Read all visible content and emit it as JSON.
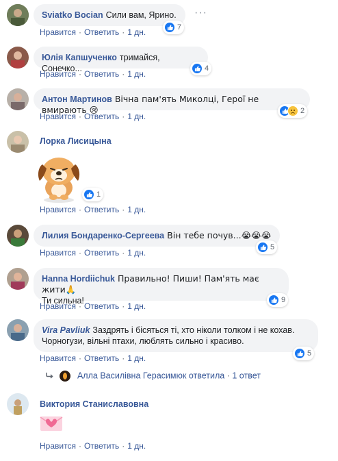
{
  "actions": {
    "like": "Нравится",
    "reply": "Ответить",
    "time": "1 дн."
  },
  "comments": [
    {
      "author": "Sviatko Bocian",
      "text": "Сили вам, Ярино.",
      "reactions": "7"
    },
    {
      "author": "Юлія Капшученко",
      "text": "тримайся, Сонечко...",
      "reactions": "4"
    },
    {
      "author": "Антон Мартинов",
      "text": "Вічна пам'ять Миколці, Герої не вмирають 😢",
      "reactions": "2"
    },
    {
      "author": "Лорка Лисицына",
      "text": "",
      "reactions": "1"
    },
    {
      "author": "Лилия Бондаренко-Сергеева",
      "text": "Він тебе почув...😭😭😭",
      "reactions": "5"
    },
    {
      "author": "Hanna Hordiichuk",
      "text": "Правильно! Пиши! Пам'ять має жити🙏",
      "text2": "Ти сильна!",
      "reactions": "9"
    },
    {
      "author": "Vira Pavliuk",
      "text": "Заздрять і бісяться ті, хто ніколи толком і не кохав.",
      "text2": "Чорногузи, вільні птахи, люблять сильно і красиво.",
      "reactions": "5"
    },
    {
      "author": "Виктория Станиславовна",
      "text": "",
      "reactions": ""
    }
  ],
  "reply": {
    "author": "Алла Василівна Герасимюк",
    "verb": "ответила",
    "count": "1 ответ"
  },
  "icons": {
    "like": "thumbs-up-icon",
    "sad": "sad-face-icon",
    "more": "more-options-icon",
    "reply": "reply-arrow-icon",
    "sticker": "puppy-sticker",
    "envelope": "heart-envelope-icon"
  },
  "colors": {
    "link": "#385898",
    "bubble": "#f2f3f5",
    "like": "#1877f2",
    "meta": "#606770"
  }
}
